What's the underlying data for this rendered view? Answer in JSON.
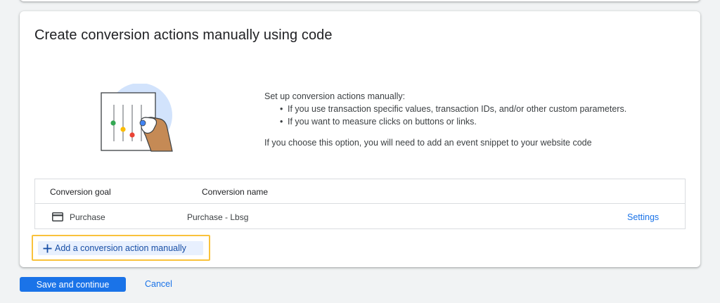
{
  "section": {
    "title": "Create conversion actions manually using code"
  },
  "description": {
    "intro": "Set up conversion actions manually:",
    "bullets": [
      "If you use transaction specific values, transaction IDs, and/or other custom parameters.",
      "If you want to measure clicks on buttons or links."
    ],
    "note": "If you choose this option, you will need to add an event snippet to your website code"
  },
  "table": {
    "headers": {
      "goal": "Conversion goal",
      "name": "Conversion name"
    },
    "rows": [
      {
        "goal": "Purchase",
        "goal_icon": "credit-card-icon",
        "name": "Purchase - Lbsg",
        "action": "Settings"
      }
    ]
  },
  "add_action": {
    "icon": "plus-icon",
    "label": "Add a conversion action manually"
  },
  "footer": {
    "save_label": "Save and continue",
    "cancel_label": "Cancel"
  },
  "colors": {
    "primary": "#1a73e8",
    "highlight_border": "#f9c23c",
    "add_button_bg": "#e8f0fe"
  }
}
